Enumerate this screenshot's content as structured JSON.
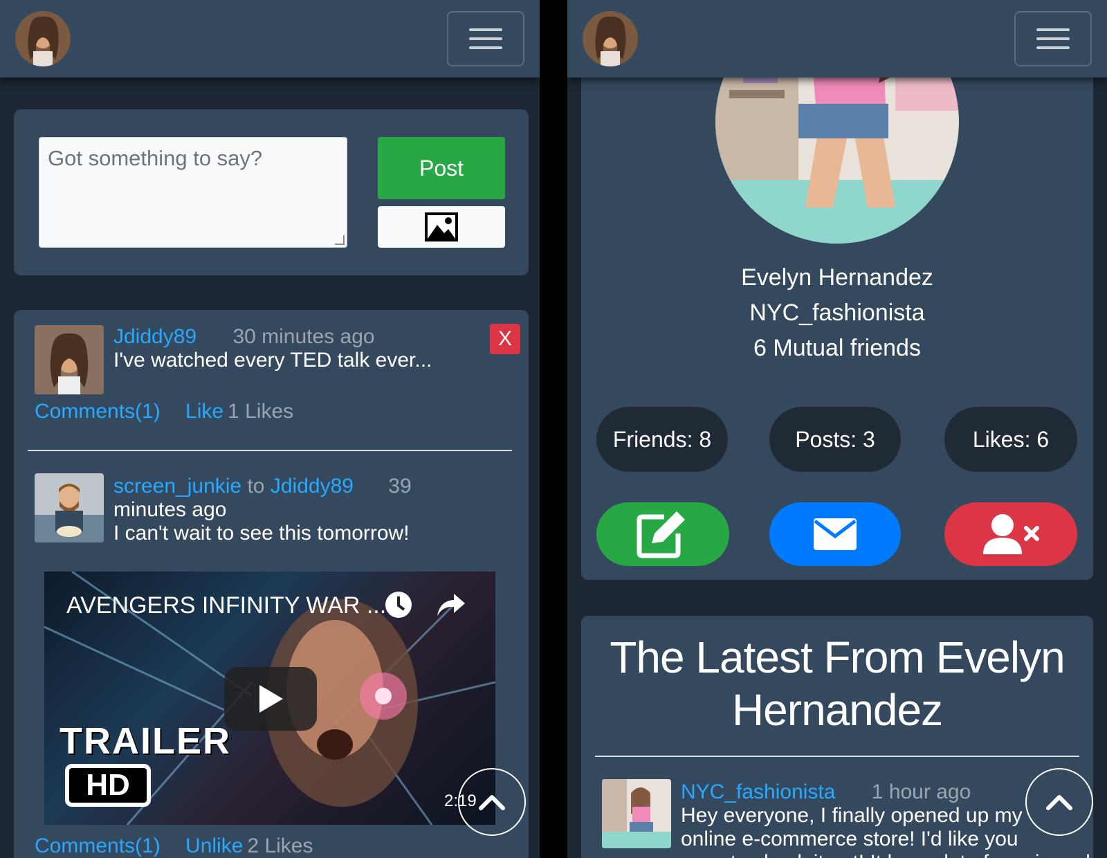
{
  "left": {
    "composer": {
      "placeholder": "Got something to say?",
      "post_label": "Post",
      "image_icon": "image-icon"
    },
    "posts": [
      {
        "author": "Jdiddy89",
        "time": "30 minutes ago",
        "text": "I've watched every TED talk ever...",
        "delete_label": "X",
        "comments": "Comments(1)",
        "like_action": "Like",
        "likes": "1 Likes"
      },
      {
        "author": "screen_junkie",
        "to_word": "to",
        "recipient": "Jdiddy89",
        "time_a": "39",
        "time_b": "minutes ago",
        "text": "I can't wait to see this tomorrow!",
        "video": {
          "title": "AVENGERS INFINITY WAR ...",
          "overlay_trailer": "TRAILER",
          "overlay_hd": "HD",
          "duration": "2:19"
        },
        "comments": "Comments(1)",
        "like_action": "Unlike",
        "likes": "2 Likes"
      }
    ]
  },
  "right": {
    "profile": {
      "name": "Evelyn Hernandez",
      "username": "NYC_fashionista",
      "mutual": "6 Mutual friends",
      "stats": {
        "friends": "Friends: 8",
        "posts": "Posts: 3",
        "likes": "Likes: 6"
      },
      "actions": {
        "edit_icon": "edit-icon",
        "message_icon": "envelope-icon",
        "unfriend_icon": "remove-user-icon"
      }
    },
    "latest": {
      "heading_line1": "The Latest From Evelyn",
      "heading_line2": "Hernandez",
      "post": {
        "author": "NYC_fashionista",
        "time": "1 hour ago",
        "line1": "Hey everyone, I finally opened up my",
        "line2": "online e-commerce store! I'd like you",
        "line3": "guys to check it out! It has a lot of manis and"
      }
    }
  },
  "colors": {
    "navbar": "#34495e",
    "background": "#1c2733",
    "card": "#34495e",
    "link": "#29a8ff",
    "success": "#28a745",
    "primary": "#007bff",
    "danger": "#dc3545",
    "pill": "#1f2a35"
  }
}
